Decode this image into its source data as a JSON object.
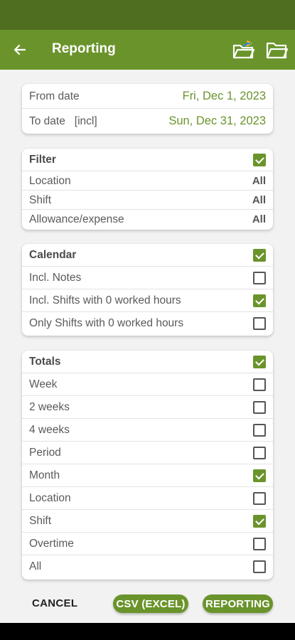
{
  "app_bar": {
    "title": "Reporting",
    "back_icon": "arrow-left-icon",
    "actions": [
      "export-folder-icon",
      "folder-open-icon"
    ]
  },
  "dates": {
    "from_label": "From date",
    "from_value": "Fri, Dec 1, 2023",
    "to_label": "To date",
    "to_incl": "[incl]",
    "to_value": "Sun, Dec 31, 2023"
  },
  "filter": {
    "title": "Filter",
    "checked": true,
    "rows": [
      {
        "label": "Location",
        "value": "All"
      },
      {
        "label": "Shift",
        "value": "All"
      },
      {
        "label": "Allowance/expense",
        "value": "All"
      }
    ]
  },
  "calendar": {
    "title": "Calendar",
    "checked": true,
    "rows": [
      {
        "label": "Incl. Notes",
        "checked": false
      },
      {
        "label": "Incl. Shifts with 0 worked hours",
        "checked": true
      },
      {
        "label": "Only Shifts with 0 worked hours",
        "checked": false
      }
    ]
  },
  "totals": {
    "title": "Totals",
    "checked": true,
    "rows": [
      {
        "label": "Week",
        "checked": false
      },
      {
        "label": "2 weeks",
        "checked": false
      },
      {
        "label": "4 weeks",
        "checked": false
      },
      {
        "label": "Period",
        "checked": false
      },
      {
        "label": "Month",
        "checked": true
      },
      {
        "label": "Location",
        "checked": false
      },
      {
        "label": "Shift",
        "checked": true
      },
      {
        "label": "Overtime",
        "checked": false
      },
      {
        "label": "All",
        "checked": false
      }
    ]
  },
  "buttons": {
    "cancel": "CANCEL",
    "csv": "CSV (EXCEL)",
    "reporting": "REPORTING"
  },
  "colors": {
    "accent": "#6a942b",
    "status_bar": "#4f6e1f"
  }
}
